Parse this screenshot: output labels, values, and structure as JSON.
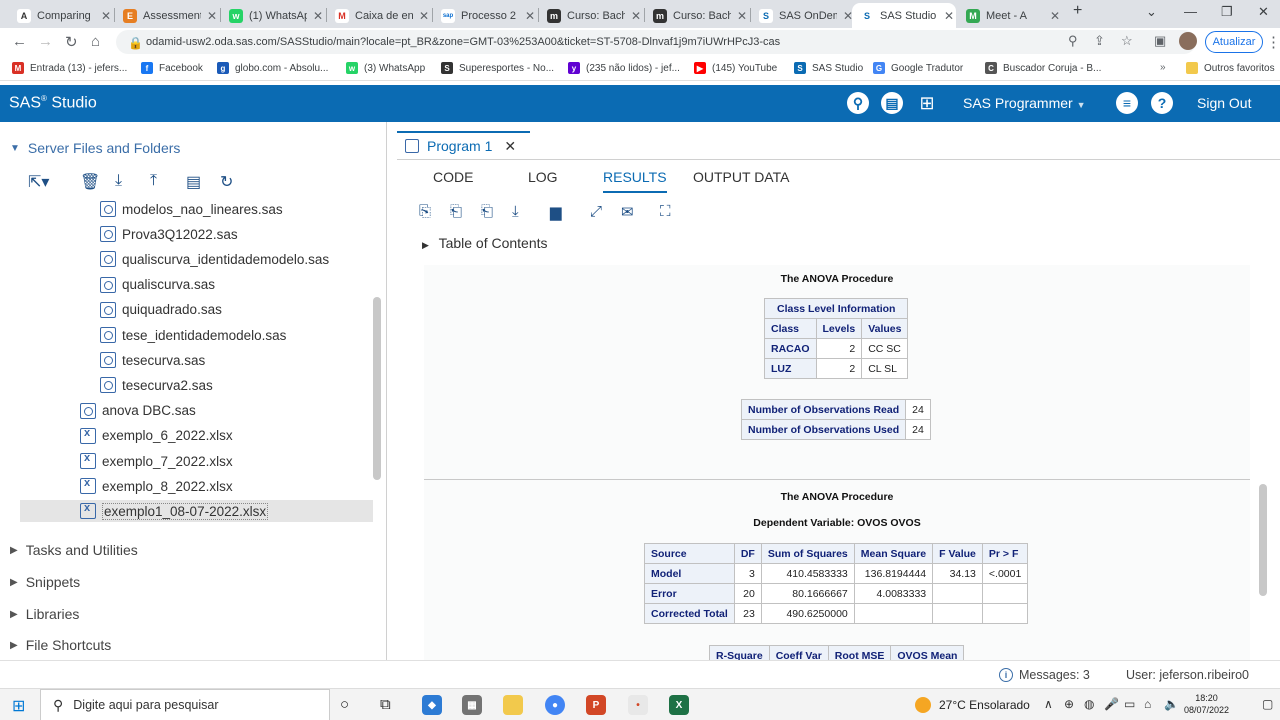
{
  "browser": {
    "tabs": [
      {
        "title": "Comparing",
        "icon": "A",
        "color": "#ffffff",
        "fg": "#333"
      },
      {
        "title": "Assessment",
        "icon": "E",
        "color": "#e67e22",
        "fg": "#fff"
      },
      {
        "title": "(1) WhatsAp",
        "icon": "w",
        "color": "#25d366",
        "fg": "#fff"
      },
      {
        "title": "Caixa de en",
        "icon": "M",
        "color": "#ffffff",
        "fg": "#d93025"
      },
      {
        "title": "Processo 2",
        "icon": "sap",
        "color": "#ffffff",
        "fg": "#0a6ed1"
      },
      {
        "title": "Curso: Bach",
        "icon": "m",
        "color": "#333333",
        "fg": "#fff"
      },
      {
        "title": "Curso: Bach",
        "icon": "m",
        "color": "#333333",
        "fg": "#fff"
      },
      {
        "title": "SAS OnDem",
        "icon": "S",
        "color": "#ffffff",
        "fg": "#0b6bb3"
      },
      {
        "title": "SAS Studio",
        "icon": "S",
        "color": "#ffffff",
        "fg": "#0b6bb3"
      },
      {
        "title": "Meet - A",
        "icon": "M",
        "color": "#34a853",
        "fg": "#fff"
      }
    ],
    "url": "odamid-usw2.oda.sas.com/SASStudio/main?locale=pt_BR&zone=GMT-03%253A00&ticket=ST-5708-Dlnvaf1j9m7iUWrHPcJ3-cas",
    "update_label": "Atualizar",
    "bookmarks": [
      {
        "label": "Entrada (13) - jefers...",
        "color": "#d93025",
        "icon": "M"
      },
      {
        "label": "Facebook",
        "color": "#1877f2",
        "icon": "f"
      },
      {
        "label": "globo.com - Absolu...",
        "color": "#1a5ab8",
        "icon": "g"
      },
      {
        "label": "(3) WhatsApp",
        "color": "#25d366",
        "icon": "w"
      },
      {
        "label": "Superesportes - No...",
        "color": "#333333",
        "icon": "S"
      },
      {
        "label": "(235 não lidos) - jef...",
        "color": "#6001d2",
        "icon": "y"
      },
      {
        "label": "(145) YouTube",
        "color": "#ff0000",
        "icon": "▶"
      },
      {
        "label": "SAS Studio",
        "color": "#0b6bb3",
        "icon": "S"
      },
      {
        "label": "Google Tradutor",
        "color": "#4285f4",
        "icon": "G"
      },
      {
        "label": "Buscador Coruja - B...",
        "color": "#555555",
        "icon": "C"
      }
    ],
    "other_favorites": "Outros favoritos"
  },
  "sas": {
    "app_title": "SAS",
    "app_title_suffix": " Studio",
    "programmer_label": "SAS Programmer",
    "sign_out": "Sign Out"
  },
  "left": {
    "server_files": "Server Files and Folders",
    "files": [
      {
        "name": "modelos_nao_lineares.sas",
        "type": "sas",
        "indent": 1
      },
      {
        "name": "Prova3Q12022.sas",
        "type": "sas",
        "indent": 1
      },
      {
        "name": "qualiscurva_identidademodelo.sas",
        "type": "sas",
        "indent": 1
      },
      {
        "name": "qualiscurva.sas",
        "type": "sas",
        "indent": 1
      },
      {
        "name": "quiquadrado.sas",
        "type": "sas",
        "indent": 1
      },
      {
        "name": "tese_identidademodelo.sas",
        "type": "sas",
        "indent": 1
      },
      {
        "name": "tesecurva.sas",
        "type": "sas",
        "indent": 1
      },
      {
        "name": "tesecurva2.sas",
        "type": "sas",
        "indent": 1
      },
      {
        "name": "anova DBC.sas",
        "type": "sas",
        "indent": 0
      },
      {
        "name": "exemplo_6_2022.xlsx",
        "type": "xl",
        "indent": 0
      },
      {
        "name": "exemplo_7_2022.xlsx",
        "type": "xl",
        "indent": 0
      },
      {
        "name": "exemplo_8_2022.xlsx",
        "type": "xl",
        "indent": 0
      },
      {
        "name": "exemplo1_08-07-2022.xlsx",
        "type": "xl",
        "indent": 0,
        "selected": true
      }
    ],
    "sections": [
      "Tasks and Utilities",
      "Snippets",
      "Libraries",
      "File Shortcuts"
    ]
  },
  "right": {
    "program_tab": "Program 1",
    "subtabs": [
      "CODE",
      "LOG",
      "RESULTS",
      "OUTPUT DATA"
    ],
    "active_subtab": "RESULTS",
    "toc": "Table of Contents",
    "proc_title_1": "The ANOVA Procedure",
    "class_level": {
      "caption": "Class Level Information",
      "headers": [
        "Class",
        "Levels",
        "Values"
      ],
      "rows": [
        [
          "RACAO",
          "2",
          "CC SC"
        ],
        [
          "LUZ",
          "2",
          "CL SL"
        ]
      ]
    },
    "observations": [
      [
        "Number of Observations Read",
        "24"
      ],
      [
        "Number of Observations Used",
        "24"
      ]
    ],
    "proc_title_2": "The ANOVA Procedure",
    "dependent_variable": "Dependent Variable: OVOS OVOS",
    "anova": {
      "headers": [
        "Source",
        "DF",
        "Sum of Squares",
        "Mean Square",
        "F Value",
        "Pr > F"
      ],
      "rows": [
        [
          "Model",
          "3",
          "410.4583333",
          "136.8194444",
          "34.13",
          "<.0001"
        ],
        [
          "Error",
          "20",
          "80.1666667",
          "4.0083333",
          "",
          ""
        ],
        [
          "Corrected Total",
          "23",
          "490.6250000",
          "",
          "",
          ""
        ]
      ]
    },
    "partial_headers": [
      "R-Square",
      "Coeff Var",
      "Root MSE",
      "OVOS Mean"
    ]
  },
  "status": {
    "messages": "Messages: 3",
    "user": "User: jeferson.ribeiro0"
  },
  "taskbar": {
    "search_placeholder": "Digite aqui para pesquisar",
    "weather": "27°C  Ensolarado",
    "time": "18:20",
    "date": "08/07/2022"
  }
}
